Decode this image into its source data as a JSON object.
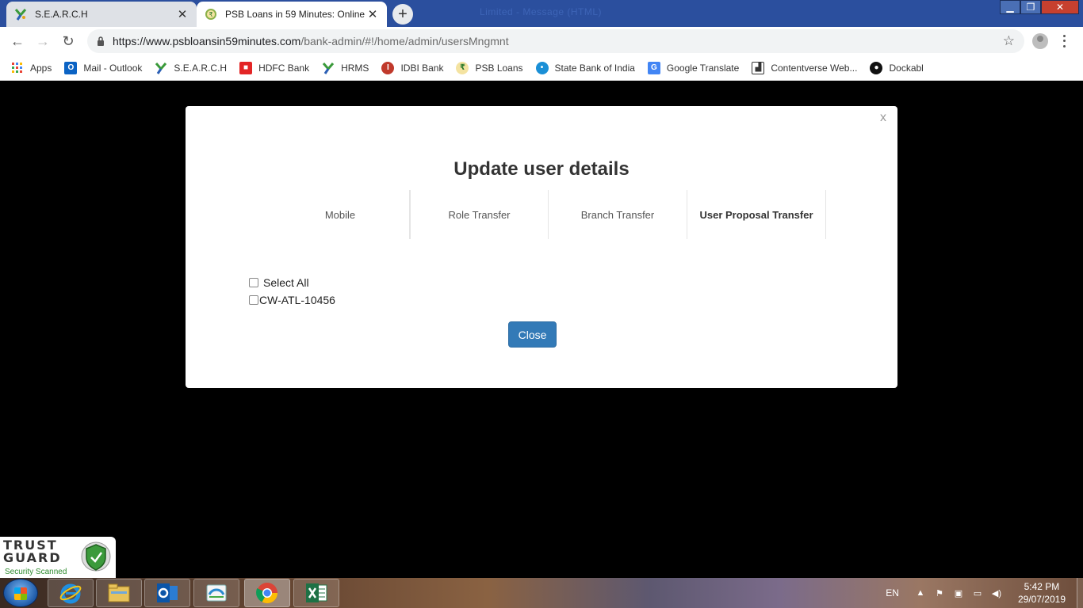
{
  "browser": {
    "tabs": [
      {
        "title": "S.E.A.R.C.H",
        "active": false
      },
      {
        "title": "PSB Loans in 59 Minutes: Online",
        "active": true
      }
    ],
    "ghost_title": "Limited - Message (HTML)",
    "url_host": "https://www.psbloansin59minutes.com",
    "url_path": "/bank-admin/#!/home/admin/usersMngmnt",
    "bookmarks": [
      {
        "label": "Apps",
        "icon": "apps-grid-icon"
      },
      {
        "label": "Mail - Outlook",
        "icon": "outlook-icon"
      },
      {
        "label": "S.E.A.R.C.H",
        "icon": "search-logo-icon"
      },
      {
        "label": "HDFC Bank",
        "icon": "hdfc-icon"
      },
      {
        "label": "HRMS",
        "icon": "hrms-icon"
      },
      {
        "label": "IDBI Bank",
        "icon": "idbi-icon"
      },
      {
        "label": "PSB Loans",
        "icon": "psb-icon"
      },
      {
        "label": "State Bank of India",
        "icon": "sbi-icon"
      },
      {
        "label": "Google Translate",
        "icon": "translate-icon"
      },
      {
        "label": "Contentverse Web...",
        "icon": "contentverse-icon"
      },
      {
        "label": "Dockabl",
        "icon": "dockabl-icon"
      }
    ]
  },
  "modal": {
    "close_glyph": "x",
    "title": "Update user details",
    "tabs": [
      "Mobile",
      "Role Transfer",
      "Branch Transfer",
      "User Proposal Transfer"
    ],
    "selected_tab": "User Proposal Transfer",
    "select_all_label": "Select All",
    "items": [
      "CW-ATL-10456"
    ],
    "close_button": "Close",
    "accent_color": "#337ab7"
  },
  "trustguard": {
    "line1": "TRUST",
    "line2": "GUARD",
    "sub": "Security Scanned"
  },
  "taskbar": {
    "lang": "EN",
    "time": "5:42 PM",
    "date": "29/07/2019",
    "apps": [
      "internet-explorer-icon",
      "file-explorer-icon",
      "outlook-icon",
      "app-icon",
      "chrome-icon",
      "excel-icon"
    ]
  }
}
